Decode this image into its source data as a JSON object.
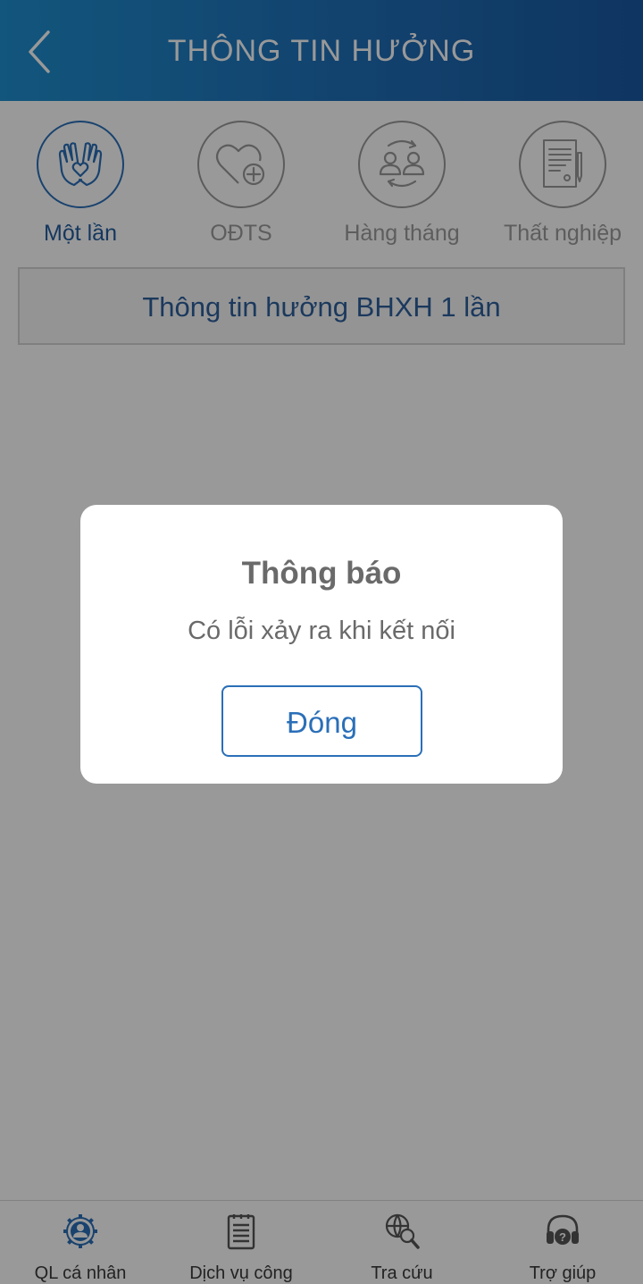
{
  "header": {
    "title": "THÔNG TIN HƯỞNG"
  },
  "tabs": [
    {
      "label": "Một lần",
      "icon": "hands-heart-icon",
      "active": true
    },
    {
      "label": "OĐTS",
      "icon": "heart-plus-icon",
      "active": false
    },
    {
      "label": "Hàng tháng",
      "icon": "people-exchange-icon",
      "active": false
    },
    {
      "label": "Thất nghiệp",
      "icon": "document-pen-icon",
      "active": false
    }
  ],
  "section": {
    "title": "Thông tin hưởng BHXH 1 lần"
  },
  "dialog": {
    "title": "Thông báo",
    "message": "Có lỗi xảy ra khi kết nối",
    "button_label": "Đóng"
  },
  "bottom_nav": [
    {
      "label": "QL cá nhân",
      "icon": "user-gear-icon"
    },
    {
      "label": "Dịch vụ công",
      "icon": "document-list-icon"
    },
    {
      "label": "Tra cứu",
      "icon": "globe-search-icon"
    },
    {
      "label": "Trợ giúp",
      "icon": "headset-help-icon"
    }
  ],
  "colors": {
    "header_start": "#1e8fd0",
    "header_end": "#1a5aa3",
    "accent": "#2a6fb8",
    "overlay": "rgba(0,0,0,0.4)"
  }
}
